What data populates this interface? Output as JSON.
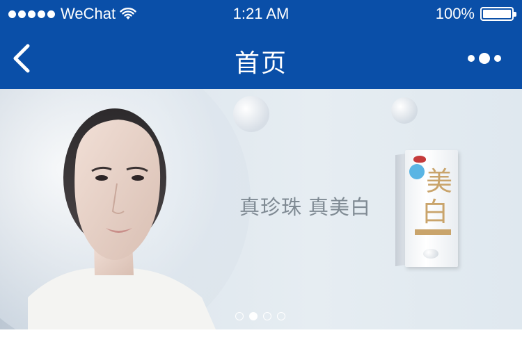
{
  "status_bar": {
    "carrier": "WeChat",
    "time": "1:21 AM",
    "battery": "100%",
    "battery_level": 1.0,
    "signal_bars": 5,
    "icons": [
      "signal-dots",
      "wifi-icon",
      "battery-icon"
    ]
  },
  "nav": {
    "title": "首页",
    "icons": [
      "chevron-left-icon",
      "more-dots-icon"
    ]
  },
  "banner": {
    "tagline": "真珍珠   真美白",
    "product_chars": [
      "美",
      "白"
    ],
    "carousel": {
      "count": 4,
      "active_index": 1
    }
  },
  "colors": {
    "brand_blue": "#0a4fa8",
    "tagline_gray": "#7f8a93",
    "product_gold": "#c9a46b"
  }
}
